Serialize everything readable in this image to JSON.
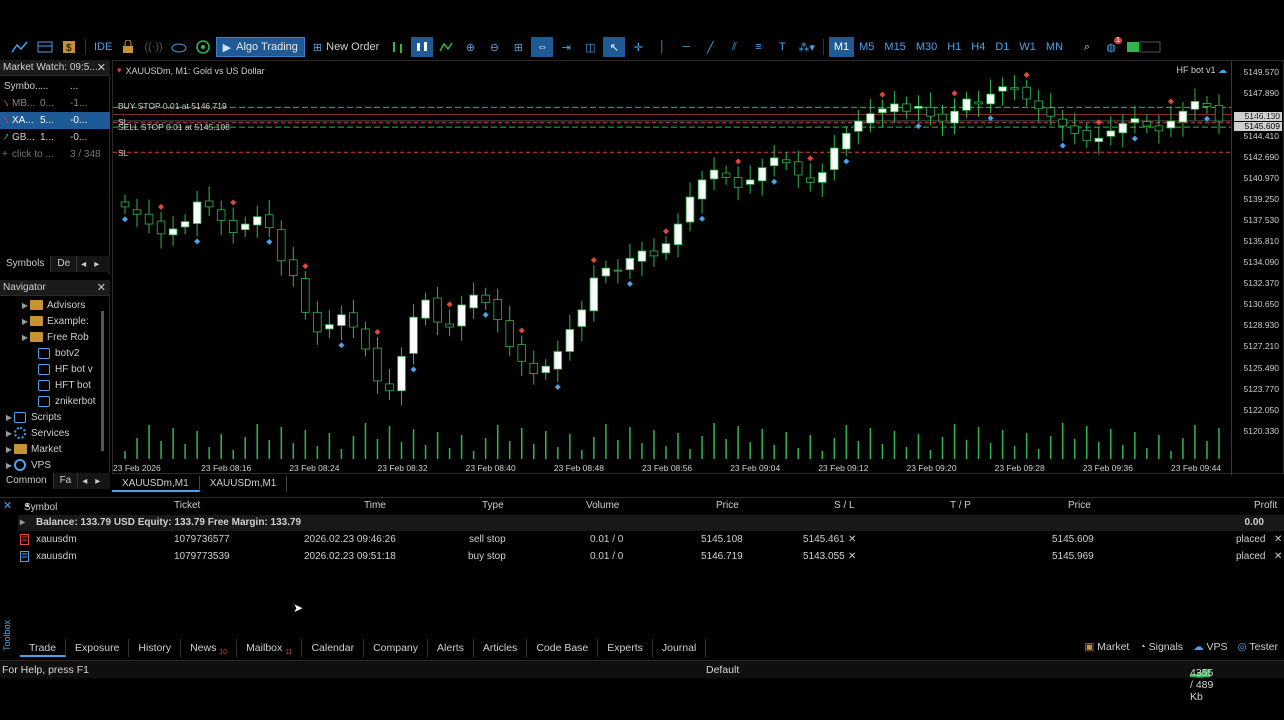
{
  "toolbar": {
    "ide_label": "IDE",
    "algo_label": "Algo Trading",
    "new_order_label": "New Order",
    "timeframes": [
      "M1",
      "M5",
      "M15",
      "M30",
      "H1",
      "H4",
      "D1",
      "W1",
      "MN"
    ],
    "active_timeframe": "M1",
    "notification_count": "1"
  },
  "market_watch": {
    "title": "Market Watch: 09:5...",
    "header": [
      "Symbo...",
      "...",
      "..."
    ],
    "rows": [
      {
        "symbol": "MB...",
        "bid": "0...",
        "ask": "-1...",
        "color": "#888888"
      },
      {
        "symbol": "XA...",
        "bid": "5...",
        "ask": "-0...",
        "color": "#ffffff"
      },
      {
        "symbol": "GB...",
        "bid": "1...",
        "ask": "-0...",
        "color": "#cfcfcf"
      }
    ],
    "add_hint": "click to ...",
    "count": "3 / 348",
    "tabs": [
      "Symbols",
      "De"
    ]
  },
  "navigator": {
    "title": "Navigator",
    "items": [
      {
        "label": "Advisors",
        "icon": "folder-icon",
        "indent": 1
      },
      {
        "label": "Example:",
        "icon": "folder-icon",
        "indent": 1
      },
      {
        "label": "Free Rob",
        "icon": "folder-icon",
        "indent": 1
      },
      {
        "label": "botv2",
        "icon": "expert-icon",
        "indent": 2
      },
      {
        "label": "HF bot v",
        "icon": "expert-icon",
        "indent": 2
      },
      {
        "label": "HFT bot",
        "icon": "expert-icon",
        "indent": 2
      },
      {
        "label": "znikerbot",
        "icon": "expert-icon",
        "indent": 2
      },
      {
        "label": "Scripts",
        "icon": "scripts-icon",
        "indent": 0
      },
      {
        "label": "Services",
        "icon": "gear-icon",
        "indent": 0
      },
      {
        "label": "Market",
        "icon": "market-icon",
        "indent": 0
      },
      {
        "label": "VPS",
        "icon": "vps-icon",
        "indent": 0
      }
    ],
    "tabs": [
      "Common",
      "Fa"
    ]
  },
  "chart": {
    "symbol_title": "XAUUSDm, M1:  Gold vs US Dollar",
    "ea_label": "HF bot v1",
    "buy_stop_label": "BUY STOP 0.01 at 5146.719",
    "sell_stop_label": "SELL STOP 0.01 at 5145.108",
    "sl_label_1": "SL",
    "sl_label_2": "SL",
    "bid_box": "5145.609",
    "ask_box": "5146.130",
    "tabs": [
      "XAUUSDm,M1",
      "XAUUSDm,M1"
    ]
  },
  "chart_data": {
    "type": "candlestick",
    "symbol": "XAUUSDm",
    "timeframe": "M1",
    "y_ticks": [
      5149.57,
      5147.89,
      5146.13,
      5144.41,
      5142.69,
      5140.97,
      5139.25,
      5137.53,
      5135.81,
      5134.09,
      5132.37,
      5130.65,
      5128.93,
      5127.21,
      5125.49,
      5123.77,
      5122.05,
      5120.33
    ],
    "x_ticks": [
      "23 Feb 2026",
      "23 Feb 08:16",
      "23 Feb 08:24",
      "23 Feb 08:32",
      "23 Feb 08:40",
      "23 Feb 08:48",
      "23 Feb 08:56",
      "23 Feb 09:04",
      "23 Feb 09:12",
      "23 Feb 09:20",
      "23 Feb 09:28",
      "23 Feb 09:36",
      "23 Feb 09:44"
    ],
    "ylim": [
      5119.5,
      5150.5
    ],
    "close_path": [
      5138.6,
      5138.0,
      5137.2,
      5136.4,
      5136.8,
      5137.4,
      5139.0,
      5138.6,
      5137.5,
      5136.5,
      5137.2,
      5137.8,
      5136.9,
      5134.2,
      5133.0,
      5130.0,
      5128.4,
      5129.0,
      5129.8,
      5128.8,
      5127.0,
      5124.4,
      5123.6,
      5126.4,
      5129.6,
      5131.0,
      5129.2,
      5128.8,
      5130.6,
      5131.4,
      5130.8,
      5129.4,
      5127.2,
      5126.0,
      5125.0,
      5125.6,
      5126.8,
      5128.6,
      5130.2,
      5132.8,
      5133.6,
      5133.4,
      5134.4,
      5135.0,
      5134.6,
      5135.6,
      5137.2,
      5139.4,
      5140.8,
      5141.6,
      5141.0,
      5140.2,
      5140.8,
      5141.8,
      5142.6,
      5142.2,
      5141.2,
      5140.6,
      5141.4,
      5143.4,
      5144.6,
      5145.6,
      5146.2,
      5146.6,
      5147.0,
      5146.4,
      5146.8,
      5146.0,
      5145.6,
      5146.4,
      5147.4,
      5147.0,
      5147.8,
      5148.4,
      5148.2,
      5147.4,
      5146.6,
      5146.0,
      5145.2,
      5144.6,
      5144.0,
      5144.2,
      5144.8,
      5145.4,
      5145.8,
      5145.2,
      5144.8,
      5145.6,
      5146.4,
      5147.2,
      5146.8,
      5145.6
    ],
    "open_orders": [
      {
        "type": "buy stop",
        "price": 5146.719,
        "sl": 5143.055
      },
      {
        "type": "sell stop",
        "price": 5145.108,
        "sl": 5145.461
      }
    ],
    "bid": 5145.609,
    "ask": 5146.13,
    "colors": {
      "bull": "#ffffff",
      "bear": "#000000",
      "wick": "#2db84b",
      "volume": "#2db84b",
      "buy_marker": "#4aa3e8",
      "sell_marker": "#e0483c"
    }
  },
  "terminal": {
    "columns": {
      "symbol": "Symbol",
      "ticket": "Ticket",
      "time": "Time",
      "type": "Type",
      "volume": "Volume",
      "price": "Price",
      "sl": "S / L",
      "tp": "T / P",
      "price2": "Price",
      "profit": "Profit"
    },
    "balance_line": "Balance: 133.79 USD  Equity: 133.79  Free Margin: 133.79",
    "balance_profit": "0.00",
    "orders": [
      {
        "symbol": "xauusdm",
        "ticket": "1079736577",
        "time": "2026.02.23 09:46:26",
        "type": "sell stop",
        "volume": "0.01 / 0",
        "price": "5145.108",
        "sl": "5145.461",
        "tp": "",
        "price2": "5145.609",
        "profit": "placed",
        "icon_color": "#e0483c"
      },
      {
        "symbol": "xauusdm",
        "ticket": "1079773539",
        "time": "2026.02.23 09:51:18",
        "type": "buy stop",
        "volume": "0.01 / 0",
        "price": "5146.719",
        "sl": "5143.055",
        "tp": "",
        "price2": "5145.969",
        "profit": "placed",
        "icon_color": "#4aa3e8"
      }
    ],
    "toolbox_label": "Toolbox",
    "tabs": [
      {
        "label": "Trade",
        "badge": ""
      },
      {
        "label": "Exposure",
        "badge": ""
      },
      {
        "label": "History",
        "badge": ""
      },
      {
        "label": "News",
        "badge": "10"
      },
      {
        "label": "Mailbox",
        "badge": "11"
      },
      {
        "label": "Calendar",
        "badge": ""
      },
      {
        "label": "Company",
        "badge": ""
      },
      {
        "label": "Alerts",
        "badge": ""
      },
      {
        "label": "Articles",
        "badge": ""
      },
      {
        "label": "Code Base",
        "badge": ""
      },
      {
        "label": "Experts",
        "badge": ""
      },
      {
        "label": "Journal",
        "badge": ""
      }
    ],
    "right_tools": [
      "Market",
      "Signals",
      "VPS",
      "Tester"
    ]
  },
  "status": {
    "help": "For Help, press F1",
    "profile": "Default",
    "traffic": "4355 / 489 Kb"
  }
}
